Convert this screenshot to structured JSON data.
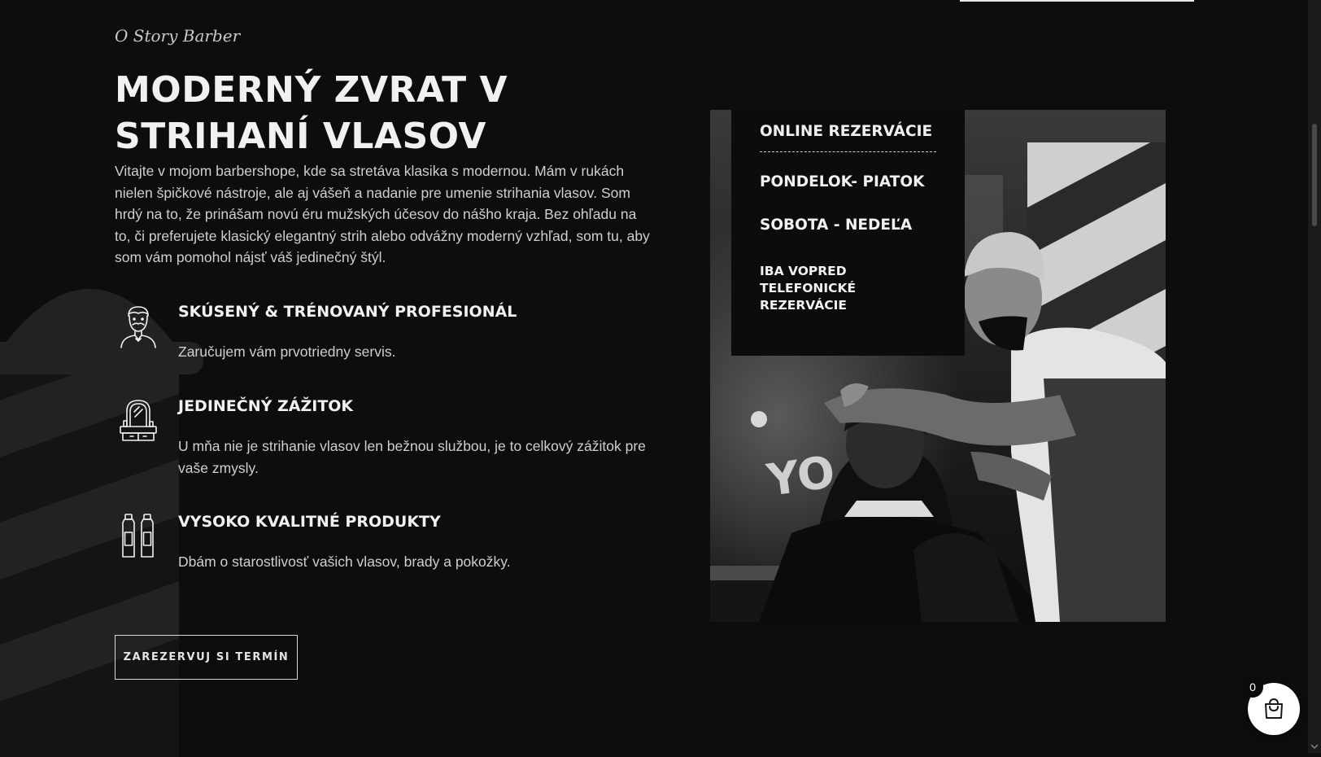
{
  "section": {
    "eyebrow": "O Story Barber",
    "title": "MODERNÝ ZVRAT V STRIHANÍ VLASOV",
    "intro": "Vitajte v mojom barbershope, kde sa stretáva klasika s modernou. Mám v rukách nielen špičkové nástroje, ale aj vášeň a nadanie pre umenie strihania vlasov. Som hrdý na to, že prinášam novú éru mužských účesov do nášho kraja. Bez ohľadu na to, či preferujete klasický elegantný strih alebo odvážny moderný vzhľad, som tu, aby som vám pomohol nájsť váš jedinečný štýl."
  },
  "features": [
    {
      "icon": "barber-man-icon",
      "title": "SKÚSENÝ & TRÉNOVANÝ PROFESIONÁL",
      "text": "Zaručujem vám prvotriedny servis."
    },
    {
      "icon": "mirror-icon",
      "title": "JEDINEČNÝ ZÁŽITOK",
      "text": "U mňa nie je strihanie vlasov len bežnou službou, je to celkový zážitok pre vaše zmysly."
    },
    {
      "icon": "bottles-icon",
      "title": "VYSOKO KVALITNÉ PRODUKTY",
      "text": "Dbám o starostlivosť vašich vlasov, brady a pokožky."
    }
  ],
  "cta": {
    "label": "ZAREZERVUJ SI TERMÍN"
  },
  "hours": {
    "online": "ONLINE REZERVÁCIE",
    "weekdays": "PONDELOK- PIATOK",
    "weekend": "SOBOTA - NEDEĽA",
    "phone_only": "IBA VOPRED TELEFONICKÉ REZERVÁCIE"
  },
  "cart": {
    "count": "0",
    "icon": "shopping-bag-icon"
  },
  "colors": {
    "background": "#0d0d0e",
    "text": "#f1f1f1",
    "muted_text": "#cfcfcf"
  }
}
